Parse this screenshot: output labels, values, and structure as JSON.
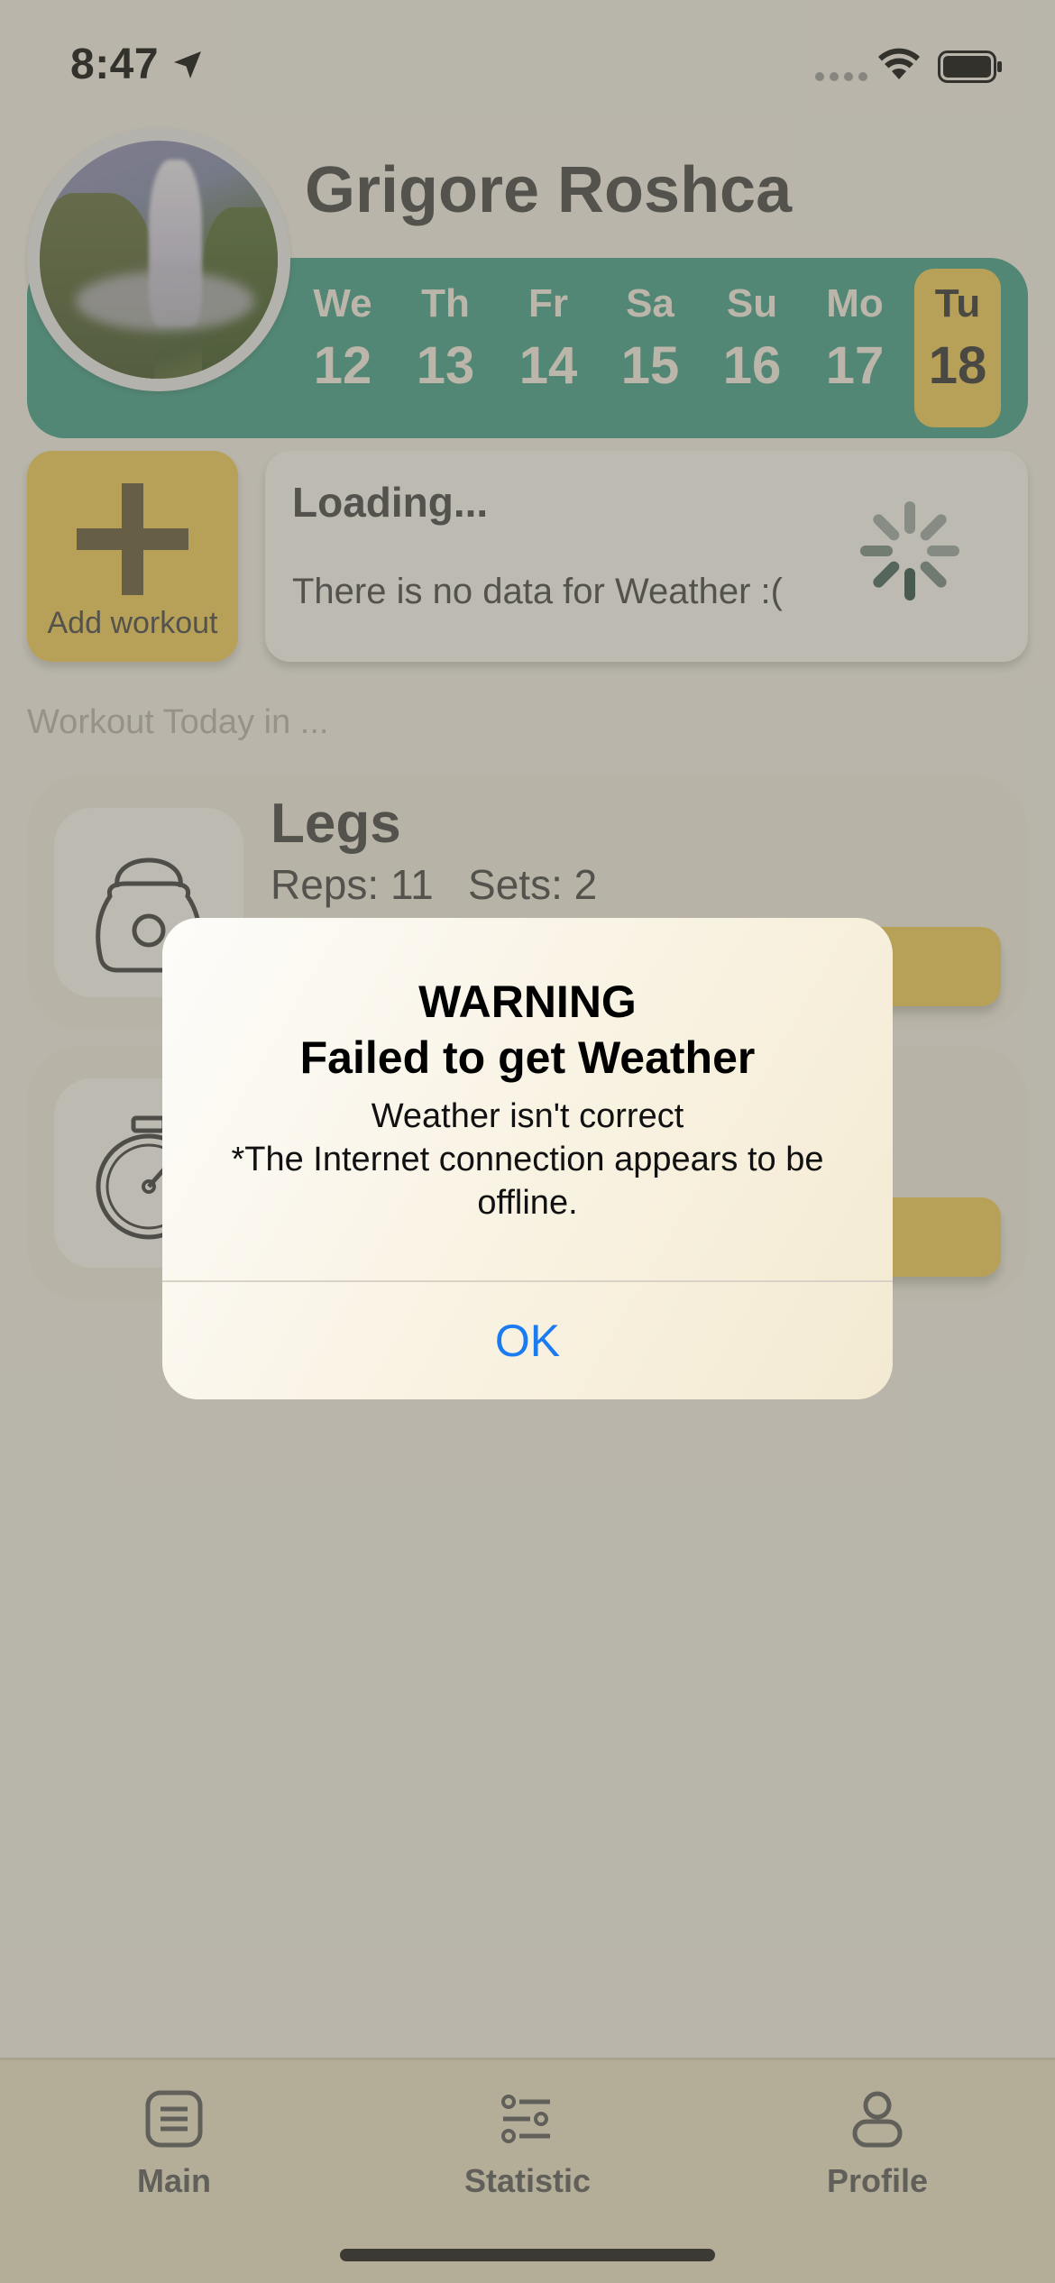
{
  "status_bar": {
    "time": "8:47"
  },
  "header": {
    "username": "Grigore Roshca"
  },
  "week": [
    {
      "name": "We",
      "date": "12"
    },
    {
      "name": "Th",
      "date": "13"
    },
    {
      "name": "Fr",
      "date": "14"
    },
    {
      "name": "Sa",
      "date": "15"
    },
    {
      "name": "Su",
      "date": "16"
    },
    {
      "name": "Mo",
      "date": "17"
    },
    {
      "name": "Tu",
      "date": "18",
      "selected": true
    }
  ],
  "add_workout": {
    "label": "Add workout"
  },
  "weather": {
    "title": "Loading...",
    "message": "There is no data for Weather :("
  },
  "section_title": "Workout Today in ...",
  "workouts": [
    {
      "name": "Legs",
      "meta": "Reps: 11   Sets: 2",
      "icon": "kettlebell-icon"
    },
    {
      "name": "",
      "meta": "",
      "icon": "stopwatch-icon"
    }
  ],
  "alert": {
    "title_line1": "WARNING",
    "title_line2": "Failed to get Weather",
    "message_line1": "Weather isn't correct",
    "message_line2": "*The Internet connection appears to be offline.",
    "ok_label": "OK"
  },
  "tabbar": [
    {
      "label": "Main",
      "icon": "document-icon"
    },
    {
      "label": "Statistic",
      "icon": "sliders-icon"
    },
    {
      "label": "Profile",
      "icon": "person-icon"
    }
  ],
  "colors": {
    "accent_green": "#3a9b87",
    "accent_yellow": "#f1cd55",
    "link_blue": "#1a7cf0"
  }
}
